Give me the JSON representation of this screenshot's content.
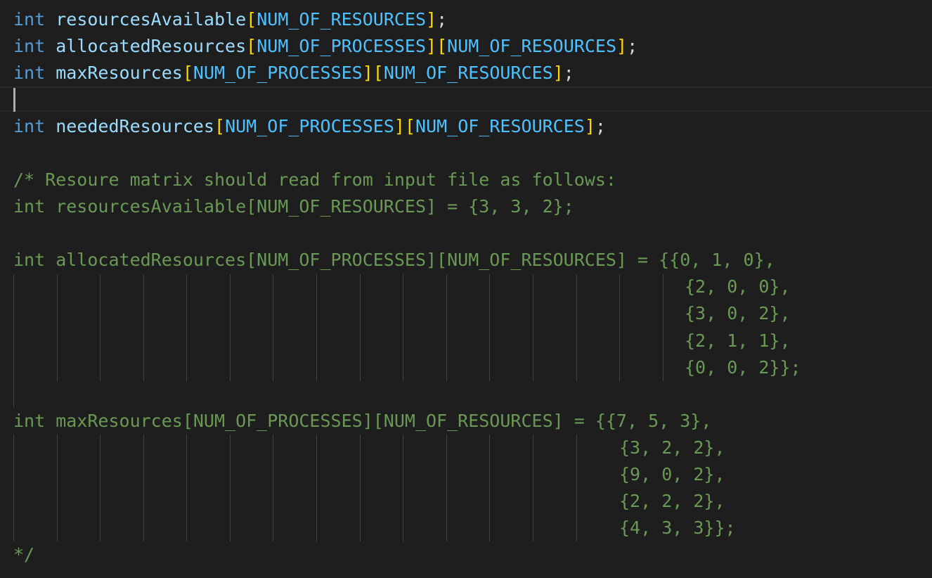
{
  "editor": {
    "language": "c",
    "cursor_line": 4,
    "colors": {
      "background": "#1e1e1e",
      "keyword": "#569cd6",
      "variable": "#9cdcfe",
      "constant": "#4fc1ff",
      "bracket": "#ffd700",
      "comment": "#6a9955",
      "text": "#d4d4d4"
    },
    "code": {
      "l1": {
        "type": "int",
        "name": "resourcesAvailable",
        "b1": "[",
        "c1": "NUM_OF_RESOURCES",
        "b2": "]",
        "end": ";"
      },
      "l2": {
        "type": "int",
        "name": "allocatedResources",
        "b1": "[",
        "c1": "NUM_OF_PROCESSES",
        "b2": "]",
        "b3": "[",
        "c2": "NUM_OF_RESOURCES",
        "b4": "]",
        "end": ";"
      },
      "l3": {
        "type": "int",
        "name": "maxResources",
        "b1": "[",
        "c1": "NUM_OF_PROCESSES",
        "b2": "]",
        "b3": "[",
        "c2": "NUM_OF_RESOURCES",
        "b4": "]",
        "end": ";"
      },
      "l5": {
        "type": "int",
        "name": "neededResources",
        "b1": "[",
        "c1": "NUM_OF_PROCESSES",
        "b2": "]",
        "b3": "[",
        "c2": "NUM_OF_RESOURCES",
        "b4": "]",
        "end": ";"
      }
    },
    "comment": {
      "l7": "/* Resoure matrix should read from input file as follows:",
      "l8": "int resourcesAvailable[NUM_OF_RESOURCES] = {3, 3, 2};",
      "l10": "int allocatedResources[NUM_OF_PROCESSES][NUM_OF_RESOURCES] = {{0, 1, 0},",
      "l11": "{2, 0, 0},",
      "l12": "{3, 0, 2},",
      "l13": "{2, 1, 1},",
      "l14": "{0, 0, 2}};",
      "l16": "int maxResources[NUM_OF_PROCESSES][NUM_OF_RESOURCES] = {{7, 5, 3},",
      "l17": "{3, 2, 2},",
      "l18": "{9, 0, 2},",
      "l19": "{2, 2, 2},",
      "l20": "{4, 3, 3}};",
      "l21": "*/"
    }
  }
}
